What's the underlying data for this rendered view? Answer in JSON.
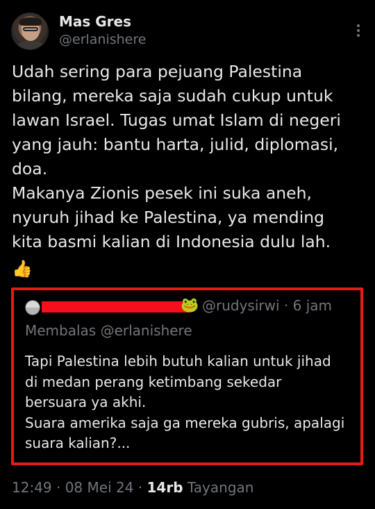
{
  "author": {
    "display_name": "Mas Gres",
    "handle": "@erlanishere"
  },
  "tweet": {
    "text": "Udah sering para pejuang Palestina\nbilang, mereka saja sudah cukup untuk\nlawan Israel. Tugas umat Islam di negeri\nyang jauh: bantu harta, julid, diplomasi,\ndoa.\nMakanya Zionis pesek ini suka aneh,\nnyuruh jihad ke Palestina, ya mending\nkita basmi kalian di Indonesia dulu lah.",
    "emoji": "👍"
  },
  "quoted_tweet": {
    "emoji": "🐸",
    "meta": "@rudysirwi · 6 jam",
    "replying_to": "Membalas @erlanishere",
    "text": "Tapi Palestina lebih butuh kalian untuk jihad\ndi medan perang ketimbang sekedar\nbersuara ya akhi.\nSuara amerika saja ga mereka gubris, apalagi\nsuara kalian?...",
    "highlight_color": "#e31b1b"
  },
  "footer": {
    "timestamp": "12:49 · 08 Mei 24 · ",
    "views_count": "14rb",
    "views_label": " Tayangan"
  },
  "icons": [
    "more-options-icon",
    "avatar",
    "thumbs-up-emoji",
    "frog-emoji"
  ]
}
